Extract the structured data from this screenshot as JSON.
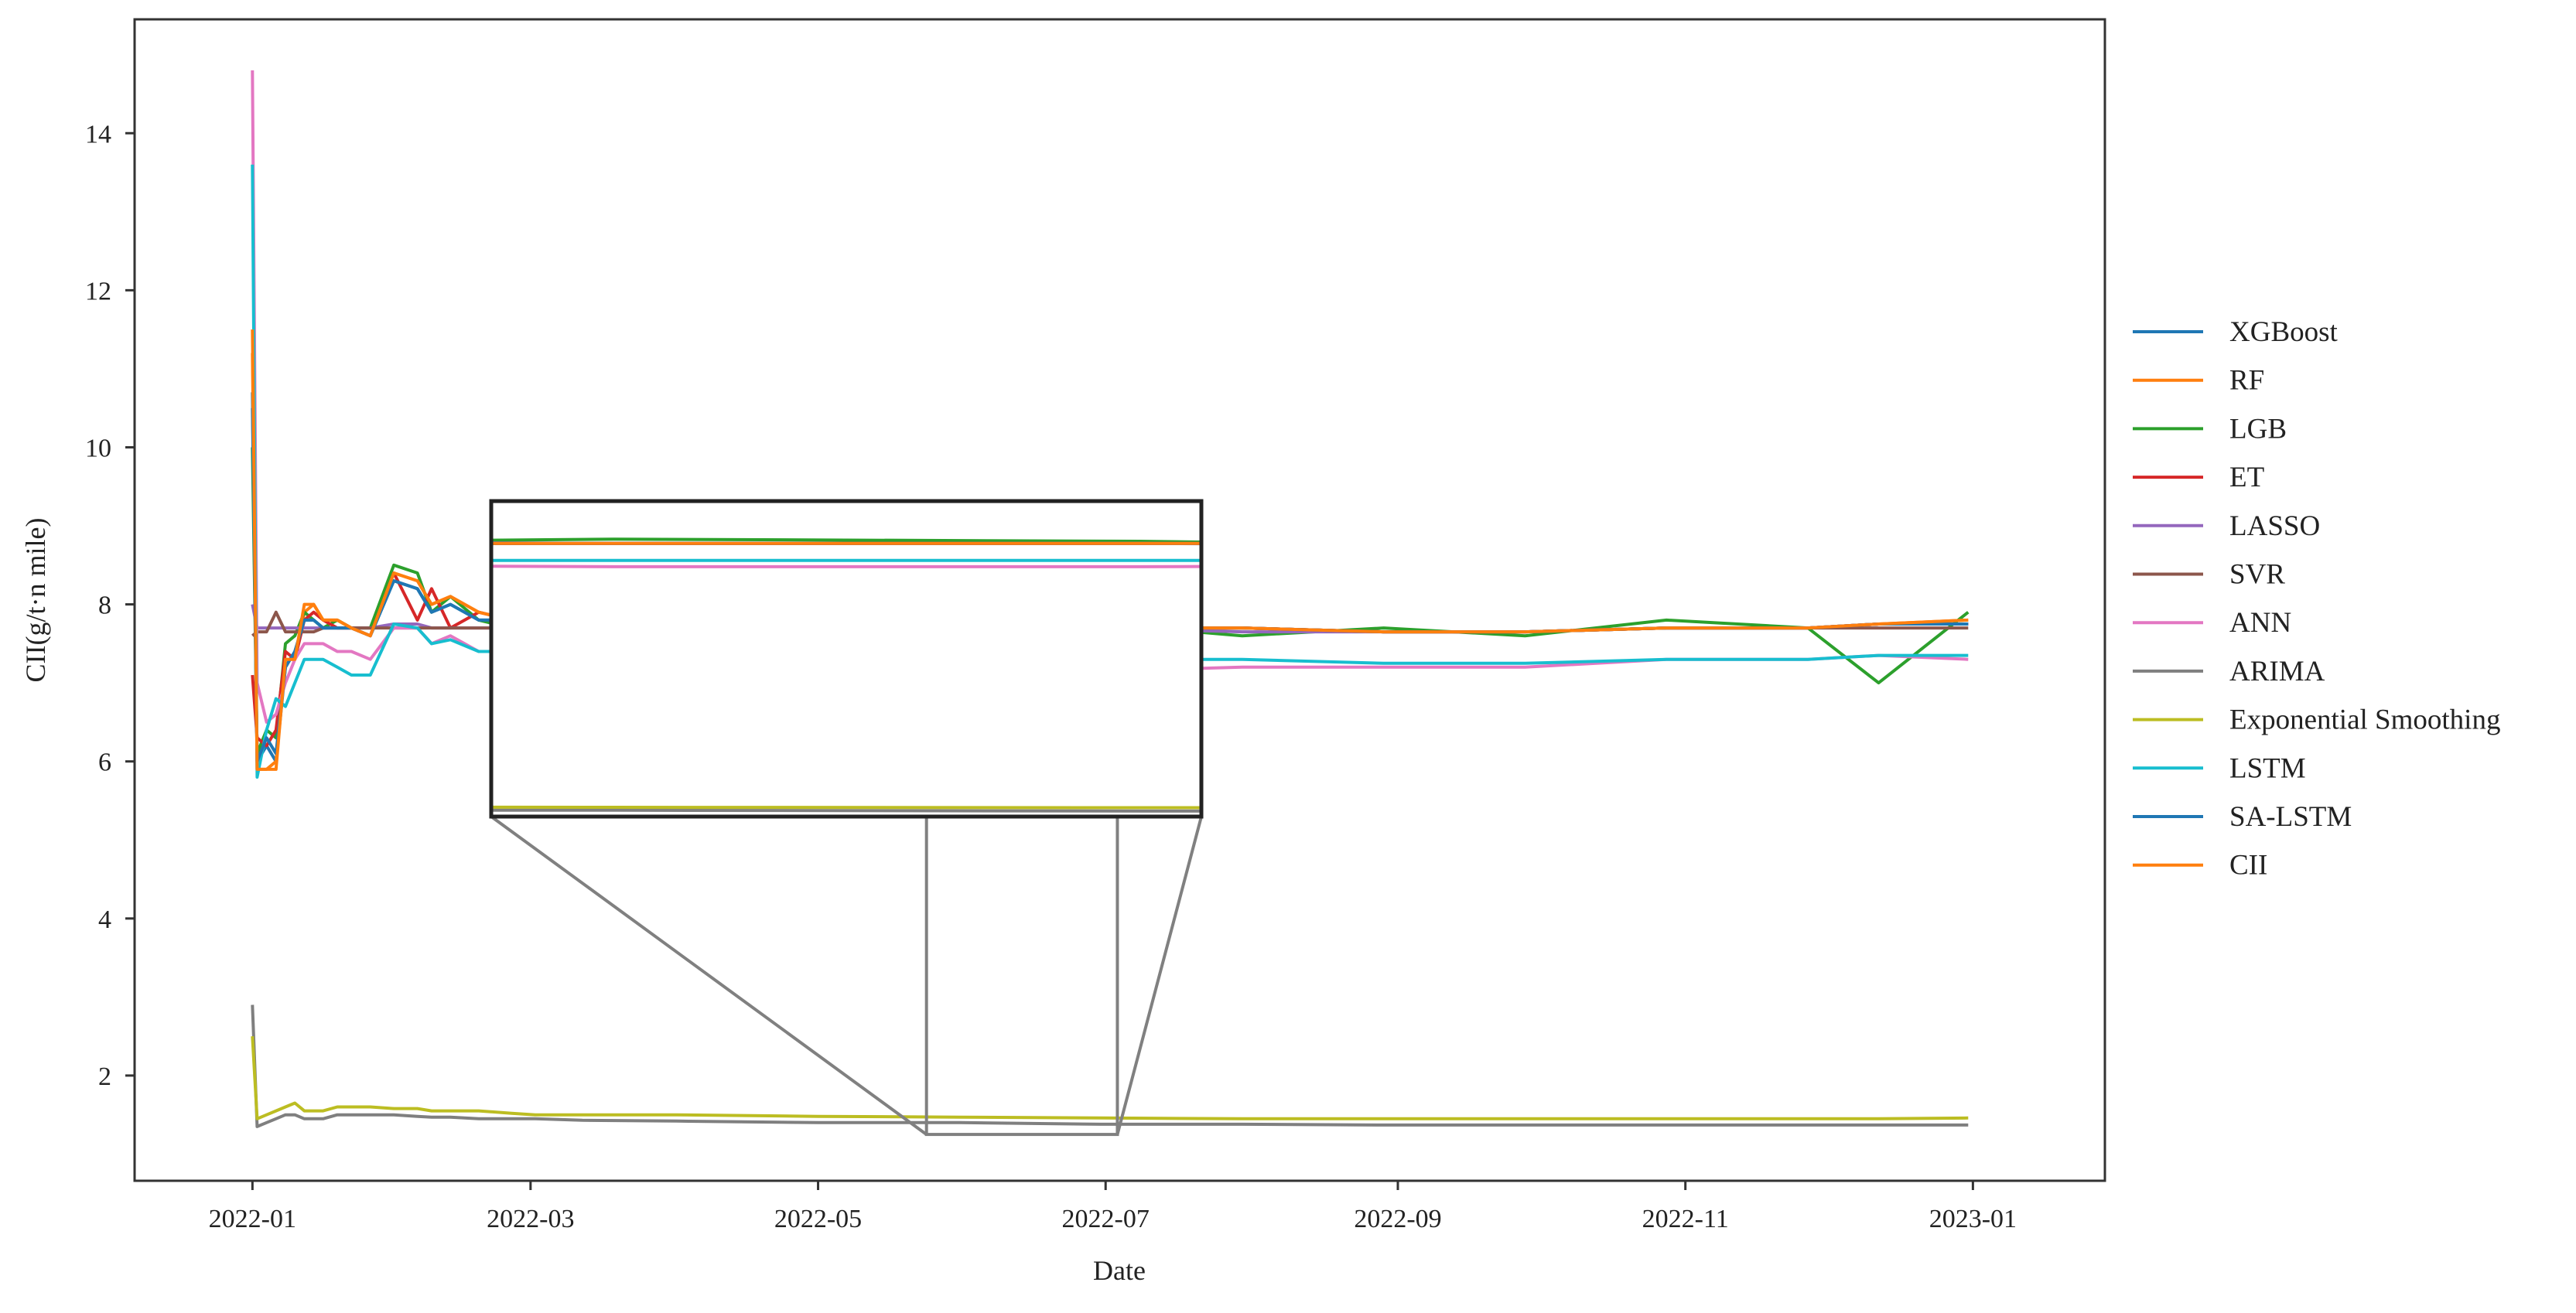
{
  "chart_data": {
    "type": "line",
    "title": "",
    "xlabel": "Date",
    "ylabel": "CII(g/t·n mile)",
    "x_unit": "days since 2022-01-01",
    "xlim": [
      -25,
      393
    ],
    "ylim": [
      0.66,
      15.45
    ],
    "xticks": [
      {
        "day": 0,
        "label": "2022-01"
      },
      {
        "day": 59,
        "label": "2022-03"
      },
      {
        "day": 120,
        "label": "2022-05"
      },
      {
        "day": 181,
        "label": "2022-07"
      },
      {
        "day": 243,
        "label": "2022-09"
      },
      {
        "day": 304,
        "label": "2022-11"
      },
      {
        "day": 365,
        "label": "2023-01"
      }
    ],
    "yticks": [
      2,
      4,
      6,
      8,
      10,
      12,
      14
    ],
    "legend_position": "right-outside",
    "x": [
      0,
      1,
      3,
      5,
      7,
      9,
      11,
      13,
      15,
      18,
      21,
      25,
      30,
      35,
      38,
      42,
      48,
      55,
      60,
      70,
      90,
      120,
      150,
      180,
      210,
      240,
      270,
      300,
      330,
      345,
      364
    ],
    "series": [
      {
        "name": "XGBoost",
        "color": "#1f77b4",
        "values": [
          10.7,
          6.0,
          6.2,
          6.0,
          7.2,
          7.4,
          7.8,
          7.8,
          7.7,
          7.7,
          7.7,
          7.6,
          8.3,
          8.2,
          7.9,
          8.0,
          7.8,
          7.8,
          7.7,
          7.7,
          7.7,
          7.7,
          7.7,
          7.7,
          7.7,
          7.65,
          7.65,
          7.7,
          7.7,
          7.75,
          7.75
        ]
      },
      {
        "name": "RF",
        "color": "#ff7f0e",
        "values": [
          11.2,
          5.9,
          5.9,
          6.0,
          7.3,
          7.3,
          7.9,
          8.0,
          7.8,
          7.8,
          7.7,
          7.6,
          8.4,
          8.3,
          8.0,
          8.1,
          7.9,
          7.8,
          7.75,
          7.7,
          7.7,
          7.7,
          7.7,
          7.7,
          7.7,
          7.65,
          7.65,
          7.7,
          7.7,
          7.75,
          7.8
        ]
      },
      {
        "name": "LGB",
        "color": "#2ca02c",
        "values": [
          10.0,
          6.1,
          6.4,
          6.3,
          7.5,
          7.6,
          7.9,
          7.8,
          7.7,
          7.8,
          7.7,
          7.7,
          8.5,
          8.4,
          7.9,
          8.1,
          7.8,
          7.7,
          7.8,
          7.6,
          7.75,
          7.7,
          7.8,
          7.75,
          7.6,
          7.7,
          7.6,
          7.8,
          7.7,
          7.0,
          7.9
        ]
      },
      {
        "name": "ET",
        "color": "#d62728",
        "values": [
          7.1,
          6.3,
          6.2,
          6.4,
          7.4,
          7.3,
          7.8,
          7.9,
          7.8,
          7.7,
          7.7,
          7.6,
          8.4,
          7.8,
          8.2,
          7.7,
          7.9,
          7.8,
          7.7,
          7.7,
          7.7,
          7.7,
          7.7,
          7.7,
          7.7,
          7.65,
          7.65,
          7.7,
          7.7,
          7.75,
          7.75
        ]
      },
      {
        "name": "LASSO",
        "color": "#9467bd",
        "values": [
          8.0,
          7.7,
          7.7,
          7.7,
          7.7,
          7.7,
          7.7,
          7.7,
          7.7,
          7.7,
          7.7,
          7.7,
          7.75,
          7.75,
          7.7,
          7.7,
          7.7,
          7.7,
          7.7,
          7.7,
          7.7,
          7.75,
          7.7,
          7.7,
          7.65,
          7.65,
          7.65,
          7.7,
          7.7,
          7.75,
          7.75
        ]
      },
      {
        "name": "SVR",
        "color": "#8c564b",
        "values": [
          7.6,
          7.65,
          7.65,
          7.9,
          7.65,
          7.65,
          7.65,
          7.65,
          7.7,
          7.7,
          7.7,
          7.7,
          7.7,
          7.7,
          7.7,
          7.7,
          7.7,
          7.7,
          7.7,
          7.7,
          7.7,
          7.7,
          7.7,
          7.7,
          7.7,
          7.65,
          7.65,
          7.7,
          7.7,
          7.7,
          7.7
        ]
      },
      {
        "name": "ANN",
        "color": "#e377c2",
        "values": [
          14.8,
          7.0,
          6.5,
          6.6,
          7.0,
          7.3,
          7.5,
          7.5,
          7.5,
          7.4,
          7.4,
          7.3,
          7.7,
          7.7,
          7.5,
          7.6,
          7.4,
          7.4,
          7.3,
          7.3,
          7.25,
          7.2,
          7.15,
          7.15,
          7.2,
          7.2,
          7.2,
          7.3,
          7.3,
          7.35,
          7.3
        ]
      },
      {
        "name": "ARIMA",
        "color": "#7f7f7f",
        "values": [
          2.9,
          1.35,
          1.4,
          1.45,
          1.5,
          1.5,
          1.45,
          1.45,
          1.45,
          1.5,
          1.5,
          1.5,
          1.5,
          1.48,
          1.47,
          1.47,
          1.45,
          1.45,
          1.45,
          1.43,
          1.42,
          1.4,
          1.4,
          1.38,
          1.38,
          1.37,
          1.37,
          1.37,
          1.37,
          1.37,
          1.37
        ]
      },
      {
        "name": "Exponential Smoothing",
        "color": "#bcbd22",
        "values": [
          2.5,
          1.45,
          1.5,
          1.55,
          1.6,
          1.65,
          1.55,
          1.55,
          1.55,
          1.6,
          1.6,
          1.6,
          1.58,
          1.58,
          1.55,
          1.55,
          1.55,
          1.52,
          1.5,
          1.5,
          1.5,
          1.48,
          1.47,
          1.46,
          1.45,
          1.45,
          1.45,
          1.45,
          1.45,
          1.45,
          1.46
        ]
      },
      {
        "name": "LSTM",
        "color": "#17becf",
        "values": [
          13.6,
          5.8,
          6.4,
          6.8,
          6.7,
          7.0,
          7.3,
          7.3,
          7.3,
          7.2,
          7.1,
          7.1,
          7.75,
          7.7,
          7.5,
          7.55,
          7.4,
          7.4,
          7.35,
          7.35,
          7.3,
          7.3,
          7.3,
          7.3,
          7.3,
          7.25,
          7.25,
          7.3,
          7.3,
          7.35,
          7.35
        ]
      },
      {
        "name": "SA-LSTM",
        "color": "#1f77b4",
        "values": [
          10.5,
          6.0,
          6.3,
          6.1,
          7.2,
          7.4,
          7.8,
          7.8,
          7.7,
          7.7,
          7.7,
          7.6,
          8.3,
          8.2,
          7.9,
          8.0,
          7.8,
          7.8,
          7.7,
          7.7,
          7.7,
          7.7,
          7.7,
          7.7,
          7.7,
          7.65,
          7.65,
          7.7,
          7.7,
          7.75,
          7.75
        ]
      },
      {
        "name": "CII",
        "color": "#ff7f0e",
        "values": [
          11.5,
          5.9,
          5.9,
          5.9,
          7.3,
          7.3,
          8.0,
          8.0,
          7.8,
          7.8,
          7.7,
          7.6,
          8.4,
          8.3,
          8.0,
          8.1,
          7.9,
          7.8,
          7.75,
          7.7,
          7.7,
          7.7,
          7.7,
          7.7,
          7.7,
          7.65,
          7.65,
          7.7,
          7.7,
          7.75,
          7.8
        ]
      }
    ],
    "inset": {
      "xlim": [
        143,
        183.5
      ],
      "ylim": [
        1.25,
        8.7
      ]
    }
  }
}
